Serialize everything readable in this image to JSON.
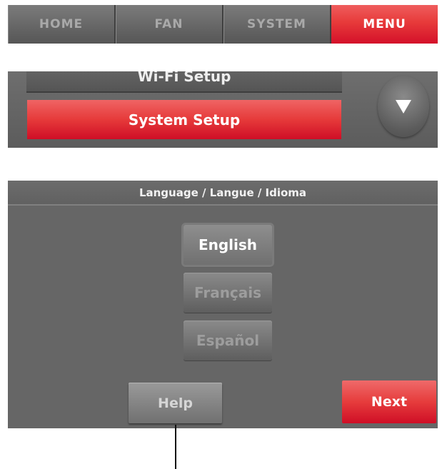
{
  "nav": {
    "tabs": [
      {
        "label": "HOME"
      },
      {
        "label": "FAN"
      },
      {
        "label": "SYSTEM"
      },
      {
        "label": "MENU",
        "active": true
      }
    ]
  },
  "menu": {
    "items": [
      {
        "label": "Wi-Fi Setup",
        "state": "partially-visible"
      },
      {
        "label": "System Setup",
        "state": "selected"
      }
    ],
    "scroll_icon": "triangle-down-icon"
  },
  "language": {
    "title": "Language / Langue /  Idioma",
    "options": [
      {
        "label": "English",
        "selected": true
      },
      {
        "label": "Français",
        "selected": false
      },
      {
        "label": "Español",
        "selected": false
      }
    ]
  },
  "footer": {
    "help_label": "Help",
    "next_label": "Next"
  },
  "colors": {
    "accent_red": "#e63a3a",
    "panel_gray": "#666666",
    "text_white": "#ffffff",
    "text_dim": "#9d9d9d"
  }
}
